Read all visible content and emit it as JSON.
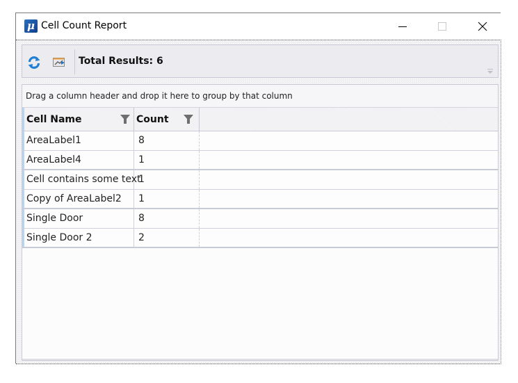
{
  "window": {
    "title": "Cell Count Report",
    "app_icon": "microstation-mu-icon",
    "app_icon_glyph": "μ",
    "controls": {
      "minimize": "minimize-icon",
      "maximize": "maximize-icon",
      "close": "close-icon",
      "close_glyph": "✕"
    }
  },
  "toolbar": {
    "refresh_icon": "refresh-icon",
    "export_icon": "export-chart-icon",
    "total_results": "Total Results: 6"
  },
  "grid": {
    "group_panel_text": "Drag a column header and drop it here to group by that column",
    "columns": [
      {
        "label": "Cell Name",
        "filter_icon": "filter-icon"
      },
      {
        "label": "Count",
        "filter_icon": "filter-icon"
      }
    ],
    "rows": [
      {
        "name": "AreaLabel1",
        "count": "8"
      },
      {
        "name": "AreaLabel4",
        "count": "1"
      },
      {
        "name": "Cell contains some text",
        "count": "1"
      },
      {
        "name": "Copy of AreaLabel2",
        "count": "1"
      },
      {
        "name": "Single Door",
        "count": "8"
      },
      {
        "name": "Single Door 2",
        "count": "2"
      }
    ]
  },
  "colors": {
    "accent_blue": "#1f6fc5",
    "row_indicator": "#b8d4f0",
    "grid_line": "#cfd0dc"
  }
}
